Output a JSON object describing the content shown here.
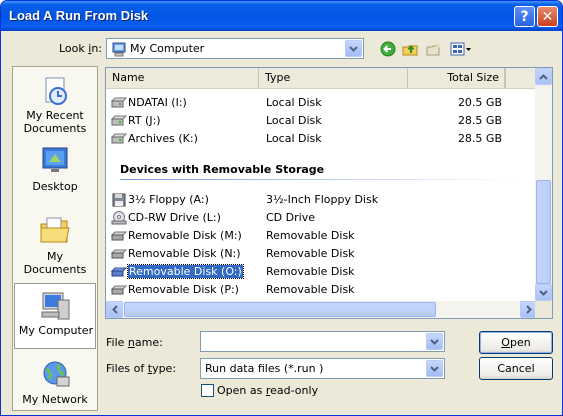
{
  "window": {
    "title": "Load A Run From Disk",
    "help_glyph": "?",
    "close_glyph": "✕"
  },
  "toolbar": {
    "lookin_label_pre": "Look ",
    "lookin_label_ul": "i",
    "lookin_label_post": "n:",
    "lookin_value": "My Computer",
    "icons": [
      "back-icon",
      "up-folder-icon",
      "new-folder-icon",
      "views-menu-icon"
    ]
  },
  "places": [
    {
      "label_line1": "My Recent",
      "label_line2": "Documents",
      "icon": "recent-documents-icon"
    },
    {
      "label_line1": "Desktop",
      "label_line2": "",
      "icon": "desktop-icon"
    },
    {
      "label_line1": "My Documents",
      "label_line2": "",
      "icon": "my-documents-icon"
    },
    {
      "label_line1": "My Computer",
      "label_line2": "",
      "icon": "my-computer-icon"
    },
    {
      "label_line1": "My Network",
      "label_line2": "",
      "icon": "my-network-icon"
    }
  ],
  "filelist": {
    "columns": {
      "name": "Name",
      "type": "Type",
      "total_size": "Total Size"
    },
    "hard_disks": [
      {
        "name": "NDATAI (I:)",
        "type": "Local Disk",
        "size": "20.5 GB"
      },
      {
        "name": "RT (J:)",
        "type": "Local Disk",
        "size": "28.5 GB"
      },
      {
        "name": "Archives (K:)",
        "type": "Local Disk",
        "size": "28.5 GB"
      }
    ],
    "removable_group_title": "Devices with Removable Storage",
    "removable": [
      {
        "name": "3½ Floppy (A:)",
        "type": "3½-Inch Floppy Disk",
        "icon": "floppy-drive-icon"
      },
      {
        "name": "CD-RW Drive (L:)",
        "type": "CD Drive",
        "icon": "cd-drive-icon"
      },
      {
        "name": "Removable Disk (M:)",
        "type": "Removable Disk",
        "icon": "removable-disk-icon"
      },
      {
        "name": "Removable Disk (N:)",
        "type": "Removable Disk",
        "icon": "removable-disk-icon"
      },
      {
        "name": "Removable Disk (O:)",
        "type": "Removable Disk",
        "icon": "removable-disk-icon",
        "selected": true
      },
      {
        "name": "Removable Disk (P:)",
        "type": "Removable Disk",
        "icon": "removable-disk-icon"
      }
    ]
  },
  "form": {
    "file_name_pre": "File ",
    "file_name_ul": "n",
    "file_name_post": "ame:",
    "file_name_value": "",
    "files_of_type_pre": "Files of ",
    "files_of_type_ul": "t",
    "files_of_type_post": "ype:",
    "files_of_type_value": "Run data files (*.run )",
    "readonly_pre": "Open as ",
    "readonly_ul": "r",
    "readonly_post": "ead-only",
    "readonly_checked": false
  },
  "buttons": {
    "open_ul": "O",
    "open_rest": "pen",
    "cancel": "Cancel"
  },
  "colors": {
    "selection": "#316ac5",
    "title_blue": "#0055e5",
    "window_bg": "#ece9d8"
  }
}
